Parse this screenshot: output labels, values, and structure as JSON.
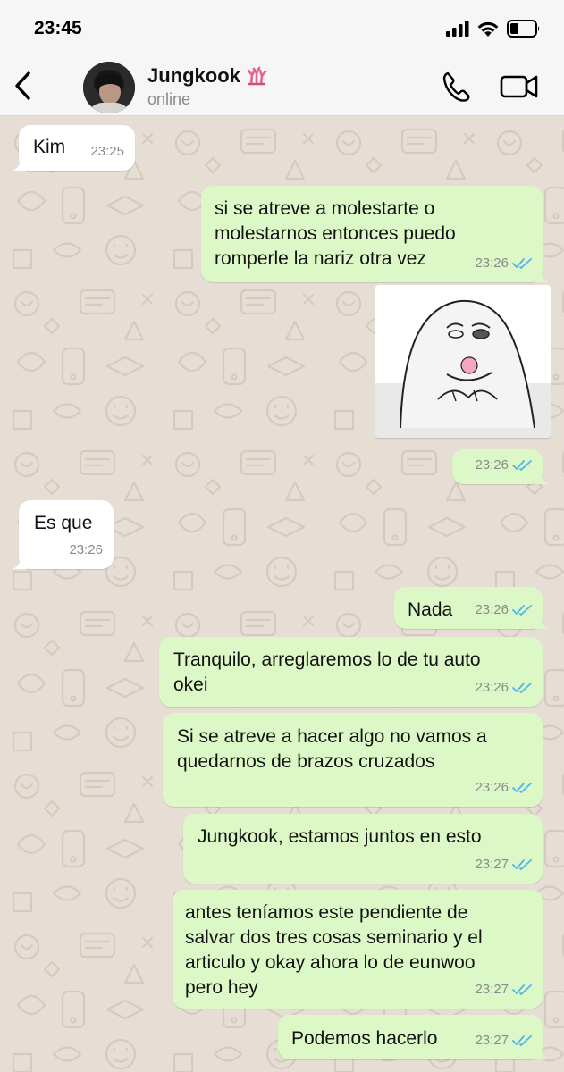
{
  "status_bar": {
    "time": "23:45"
  },
  "header": {
    "contact_name": "Jungkook",
    "contact_emoji": "coral-emoji",
    "contact_status": "online"
  },
  "colors": {
    "incoming": "#ffffff",
    "outgoing": "#dcf8c6",
    "read_ticks": "#4fb6ec",
    "wallpaper": "#e6ded4"
  },
  "messages": [
    {
      "dir": "in",
      "text": "Kim",
      "time": "23:25"
    },
    {
      "dir": "out",
      "text": "si se atreve a molestarte o\nmolestarnos entonces puedo\nromperle la nariz otra vez",
      "time": "23:26"
    },
    {
      "dir": "out",
      "type": "image",
      "content": "meme-drawing"
    },
    {
      "dir": "out",
      "text": "",
      "time": "23:26"
    },
    {
      "dir": "in",
      "text": "Es que",
      "time": "23:26"
    },
    {
      "dir": "out",
      "text": "Nada",
      "time": "23:26"
    },
    {
      "dir": "out",
      "text": "Tranquilo, arreglaremos lo de tu auto\nokei",
      "time": "23:26"
    },
    {
      "dir": "out",
      "text": "Si se atreve a hacer algo no vamos a\nquedarnos de brazos cruzados",
      "time": "23:26"
    },
    {
      "dir": "out",
      "text": "Jungkook, estamos juntos en esto",
      "time": "23:27"
    },
    {
      "dir": "out",
      "text": "antes teníamos este pendiente de\nsalvar dos tres cosas seminario y el\narticulo y okay ahora lo de eunwoo\npero hey",
      "time": "23:27"
    },
    {
      "dir": "out",
      "text": "Podemos hacerlo",
      "time": "23:27"
    }
  ]
}
